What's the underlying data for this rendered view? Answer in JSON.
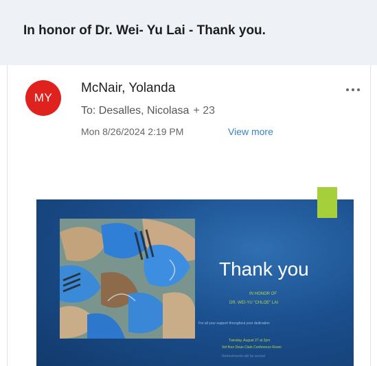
{
  "email": {
    "subject": "In honor of Dr. Wei- Yu Lai - Thank you.",
    "avatar_initials": "MY",
    "sender": "McNair, Yolanda",
    "to_label": "To: Desalles, Nicolasa",
    "recipients_more": "+ 23",
    "date": "Mon 8/26/2024 2:19 PM",
    "view_more": "View more",
    "more_icon": "more-horizontal-icon"
  },
  "slide": {
    "title": "Thank you",
    "line1": "IN HONOR OF",
    "line2": "DR. WEI-YU \"CHLOE\" LAI",
    "line3": "For all your support throughout your dedication",
    "line4": "Tuesday, August 27 at 2pm",
    "line5": "3rd floor Dean Clark Conference Room",
    "line6": "Refreshments will be served"
  },
  "colors": {
    "avatar": "#e0221f",
    "link": "#3a7fc8",
    "slide_bg": "#1b4f8e",
    "accent_green": "#a6cf3c"
  }
}
